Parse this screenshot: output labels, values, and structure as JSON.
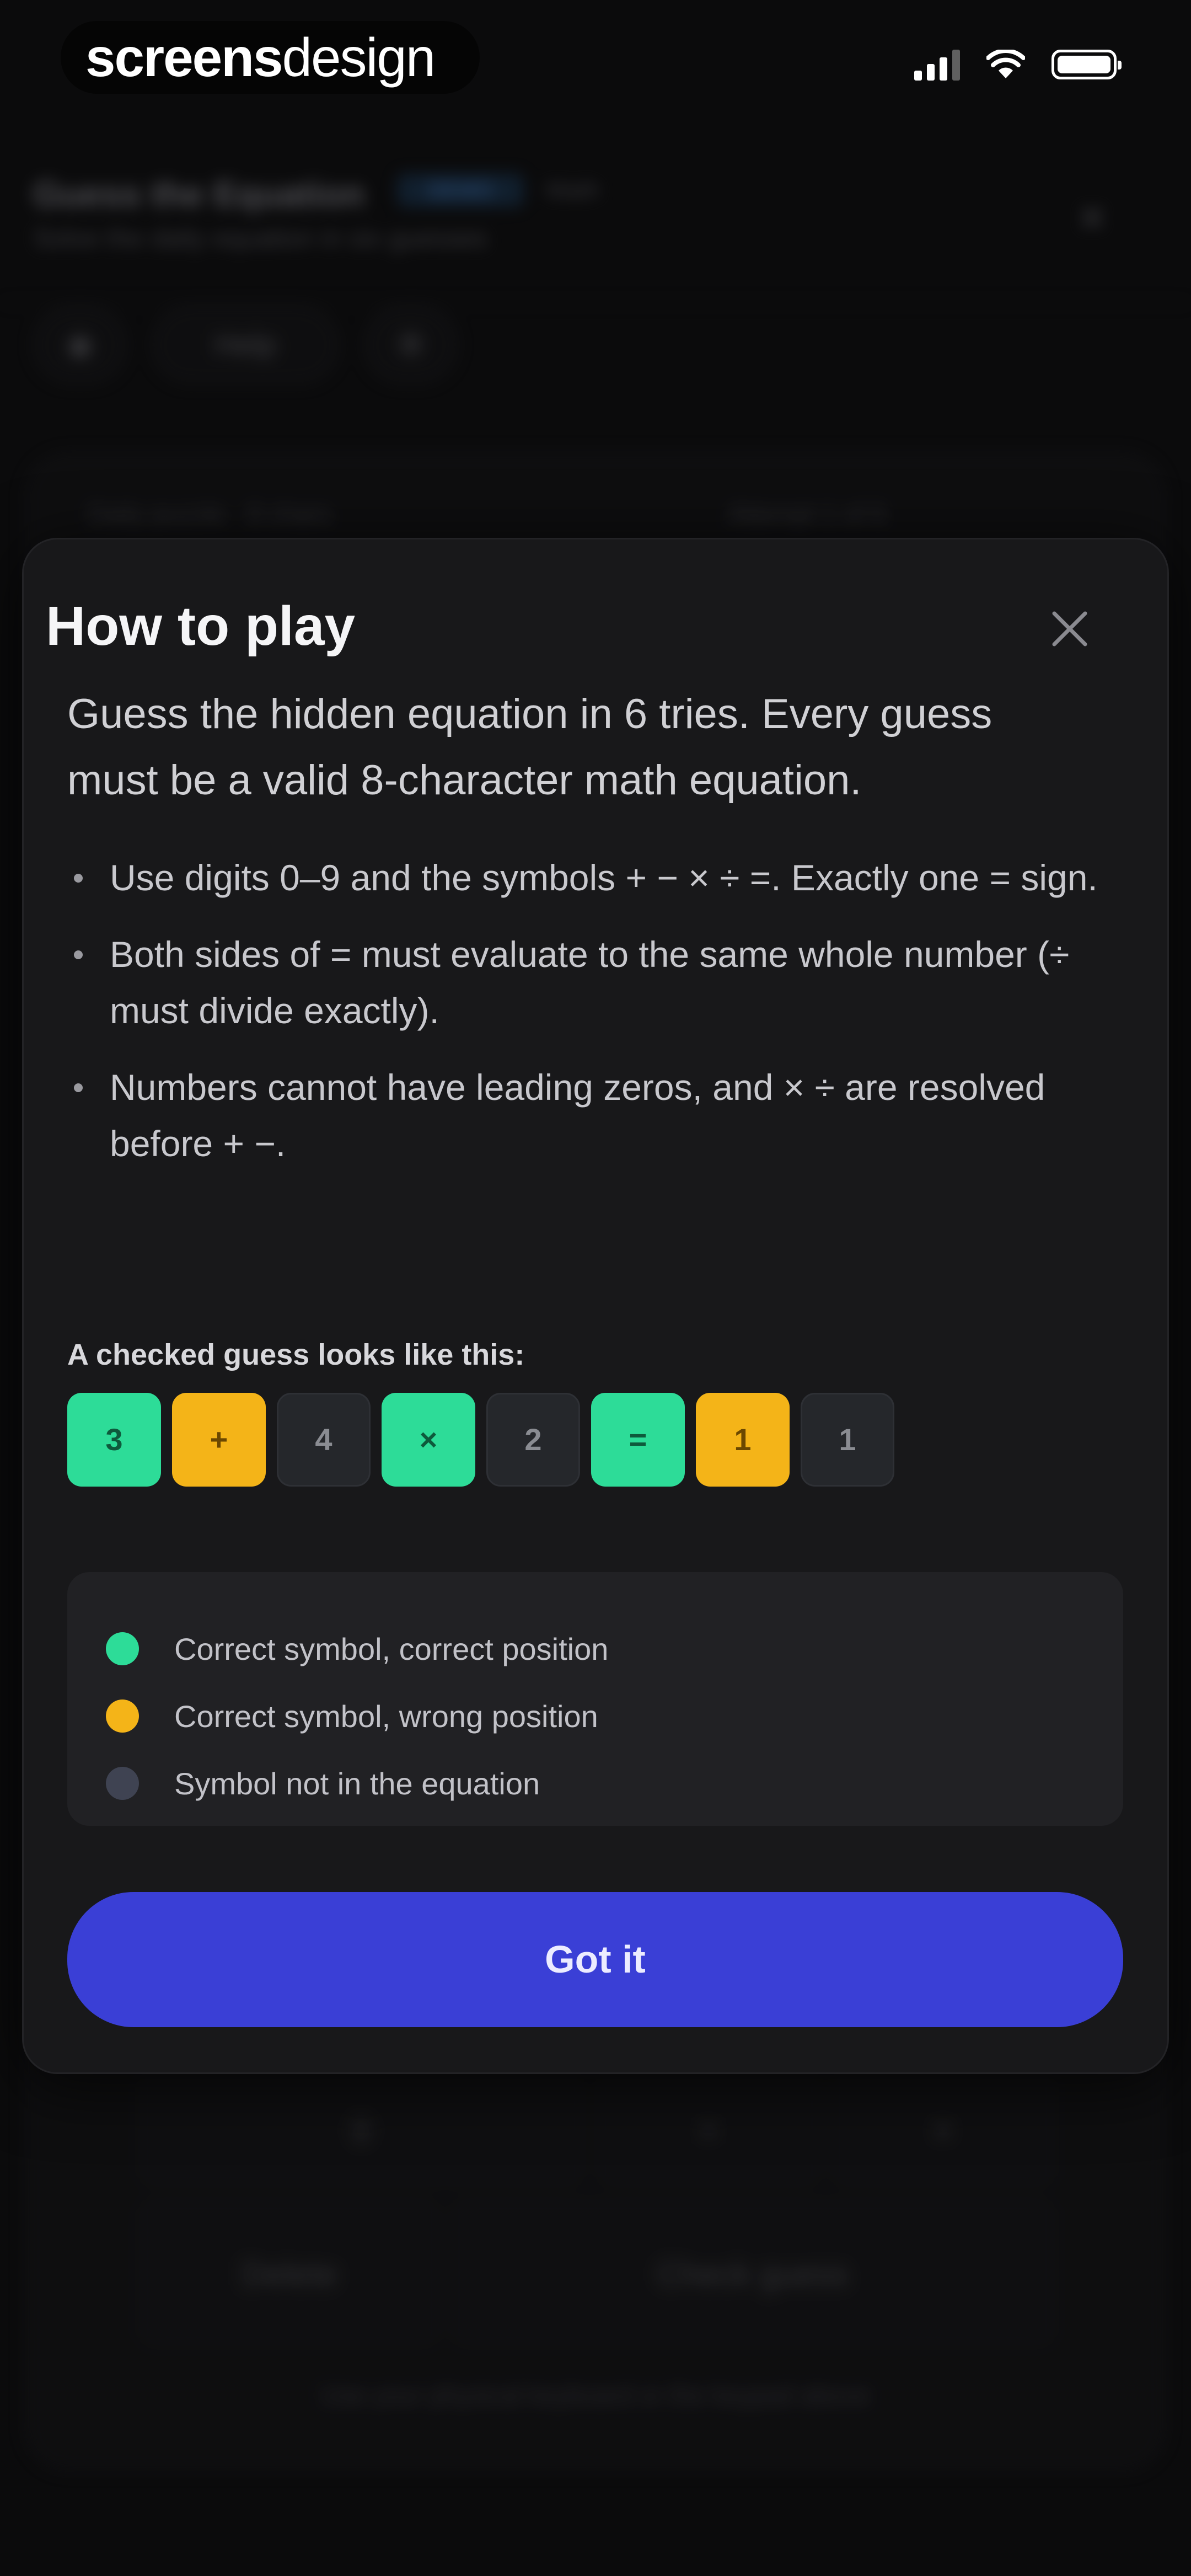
{
  "status_bar": {
    "brand_bold": "screens",
    "brand_light": "design"
  },
  "background": {
    "title": "Guess the Equation",
    "badge": "DEMO",
    "meta": "Math",
    "subtitle": "Solve the daily equation in six guesses",
    "help_label": "Help",
    "card_left": "Daily puzzle · 8 chars",
    "card_right": "Attempt 1 of 6",
    "delete_label": "Delete",
    "check_label": "Check guess",
    "footer_hint": "Use your physical keyboard or the keypad above"
  },
  "modal": {
    "title": "How to play",
    "intro": "Guess the hidden equation in 6 tries. Every guess must be a valid 8-character math equation.",
    "rules": [
      "Use digits 0–9 and the symbols + − × ÷ =. Exactly one = sign.",
      "Both sides of = must evaluate to the same whole number (÷ must divide exactly).",
      "Numbers cannot have leading zeros, and × ÷ are resolved before + −."
    ],
    "example_label": "A checked guess looks like this:",
    "example_tiles": [
      {
        "char": "3",
        "state": "correct"
      },
      {
        "char": "+",
        "state": "present"
      },
      {
        "char": "4",
        "state": "absent"
      },
      {
        "char": "×",
        "state": "correct"
      },
      {
        "char": "2",
        "state": "absent"
      },
      {
        "char": "=",
        "state": "correct"
      },
      {
        "char": "1",
        "state": "present"
      },
      {
        "char": "1",
        "state": "absent"
      }
    ],
    "legend": [
      {
        "label": "Correct symbol, correct position",
        "color": "#2ddc98"
      },
      {
        "label": "Correct symbol, wrong position",
        "color": "#f4b418"
      },
      {
        "label": "Symbol not in the equation",
        "color": "#3f4352"
      }
    ],
    "button_label": "Got it"
  },
  "colors": {
    "accent": "#3a3fd6",
    "correct": "#2ddc98",
    "present": "#f4b418",
    "absent": "#25272b"
  }
}
